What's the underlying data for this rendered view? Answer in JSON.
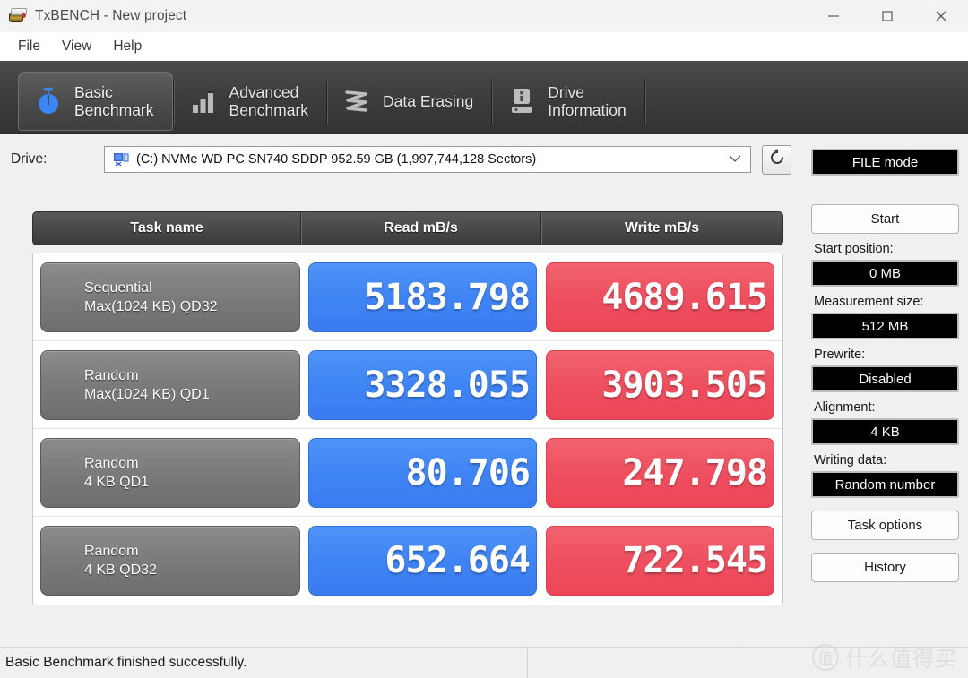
{
  "window": {
    "title": "TxBENCH - New project",
    "app_icon": "txbench-app-icon",
    "controls": {
      "minimize": "minimize-icon",
      "maximize": "maximize-icon",
      "close": "close-icon"
    }
  },
  "menu": {
    "items": [
      {
        "label": "File"
      },
      {
        "label": "View"
      },
      {
        "label": "Help"
      }
    ]
  },
  "tabs": [
    {
      "label": "Basic\nBenchmark",
      "icon": "stopwatch-icon",
      "active": true
    },
    {
      "label": "Advanced\nBenchmark",
      "icon": "bar-chart-icon",
      "active": false
    },
    {
      "label": "Data Erasing",
      "icon": "eraser-wave-icon",
      "active": false
    },
    {
      "label": "Drive\nInformation",
      "icon": "drive-info-icon",
      "active": false
    }
  ],
  "drive": {
    "label": "Drive:",
    "icon": "disk-share-icon",
    "selected": "(C:) NVMe WD PC SN740 SDDP  952.59 GB (1,997,744,128 Sectors)",
    "dropdown_arrow": "chevron-down-icon",
    "refresh_icon": "refresh-icon"
  },
  "results": {
    "columns": [
      "Task name",
      "Read mB/s",
      "Write mB/s"
    ],
    "rows": [
      {
        "task_line1": "Sequential",
        "task_line2": "Max(1024 KB) QD32",
        "read": "5183.798",
        "write": "4689.615"
      },
      {
        "task_line1": "Random",
        "task_line2": "Max(1024 KB) QD1",
        "read": "3328.055",
        "write": "3903.505"
      },
      {
        "task_line1": "Random",
        "task_line2": "4 KB QD1",
        "read": "80.706",
        "write": "247.798"
      },
      {
        "task_line1": "Random",
        "task_line2": "4 KB QD32",
        "read": "652.664",
        "write": "722.545"
      }
    ]
  },
  "sidebar": {
    "mode_button": "FILE mode",
    "start_button": "Start",
    "start_position_label": "Start position:",
    "start_position_value": "0 MB",
    "measurement_size_label": "Measurement size:",
    "measurement_size_value": "512 MB",
    "prewrite_label": "Prewrite:",
    "prewrite_value": "Disabled",
    "alignment_label": "Alignment:",
    "alignment_value": "4 KB",
    "writing_data_label": "Writing data:",
    "writing_data_value": "Random number",
    "task_options_button": "Task options",
    "history_button": "History"
  },
  "statusbar": {
    "message": "Basic Benchmark finished successfully.",
    "pane2": "",
    "pane3": ""
  },
  "watermark": {
    "logo": "值",
    "text": "什么值得买"
  },
  "colors": {
    "read_cell": "#3f84f4",
    "write_cell": "#ee4f5f",
    "tab_strip": "#3c3c3c",
    "task_cell": "#7b7b7b",
    "header_cell": "#4a4a4a",
    "window_bg": "#f0f0f0"
  }
}
